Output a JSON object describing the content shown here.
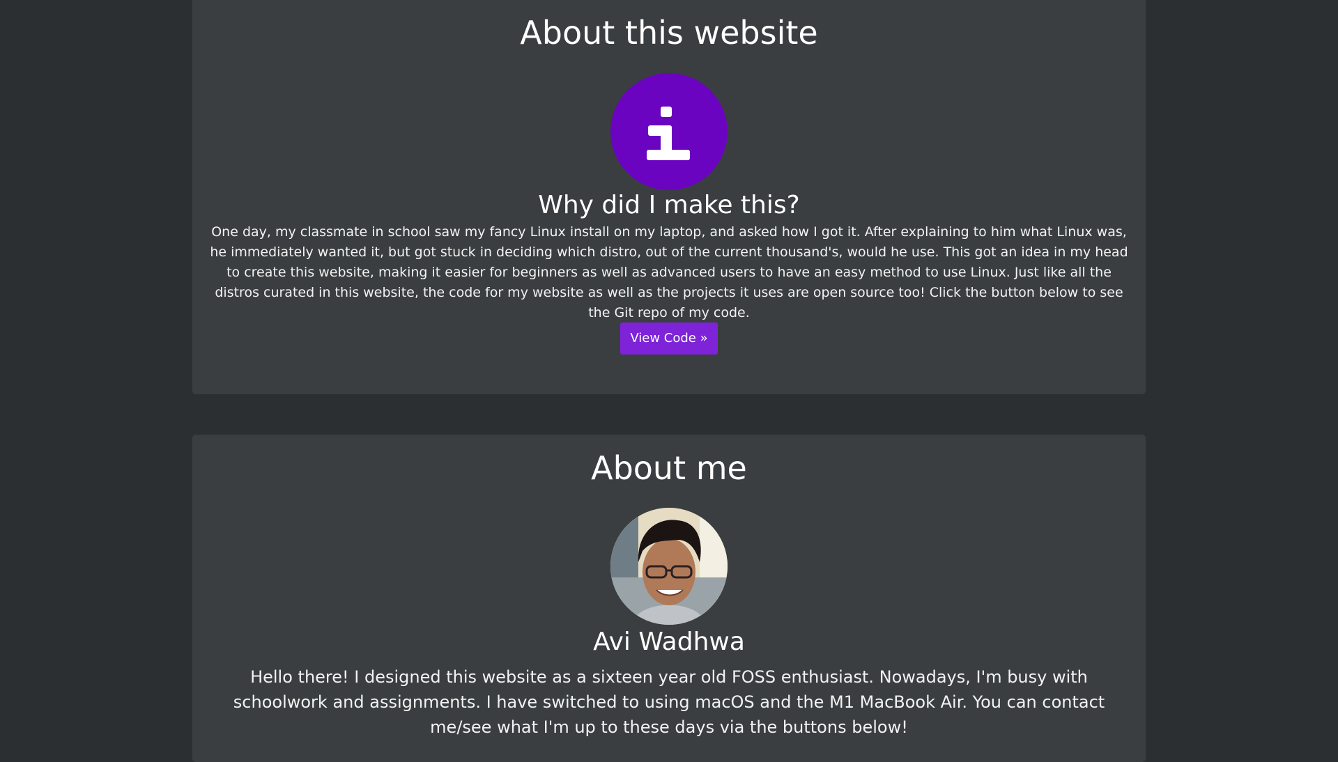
{
  "about_site": {
    "title": "About this website",
    "icon": "info-icon",
    "icon_color": "#6a04c0",
    "subtitle": "Why did I make this?",
    "paragraph": "One day, my classmate in school saw my fancy Linux install on my laptop, and asked how I got it. After explaining to him what Linux was, he immediately wanted it, but got stuck in deciding which distro, out of the current thousand's, would he use. This got an idea in my head to create this website, making it easier for beginners as well as advanced users to have an easy method to use Linux. Just like all the distros curated in this website, the code for my website as well as the projects it uses are open source too! Click the button below to see the Git repo of my code.",
    "button_label": "View Code »",
    "button_color": "#7e23d8"
  },
  "about_me": {
    "title": "About me",
    "name": "Avi Wadhwa",
    "paragraph": "Hello there! I designed this website as a sixteen year old FOSS enthusiast. Nowadays, I'm busy with schoolwork and assignments. I have switched to using macOS and the M1 MacBook Air. You can contact me/see what I'm up to these days via the buttons below!"
  },
  "colors": {
    "page_background": "#2b2f31",
    "card_background": "#3a3e40"
  }
}
